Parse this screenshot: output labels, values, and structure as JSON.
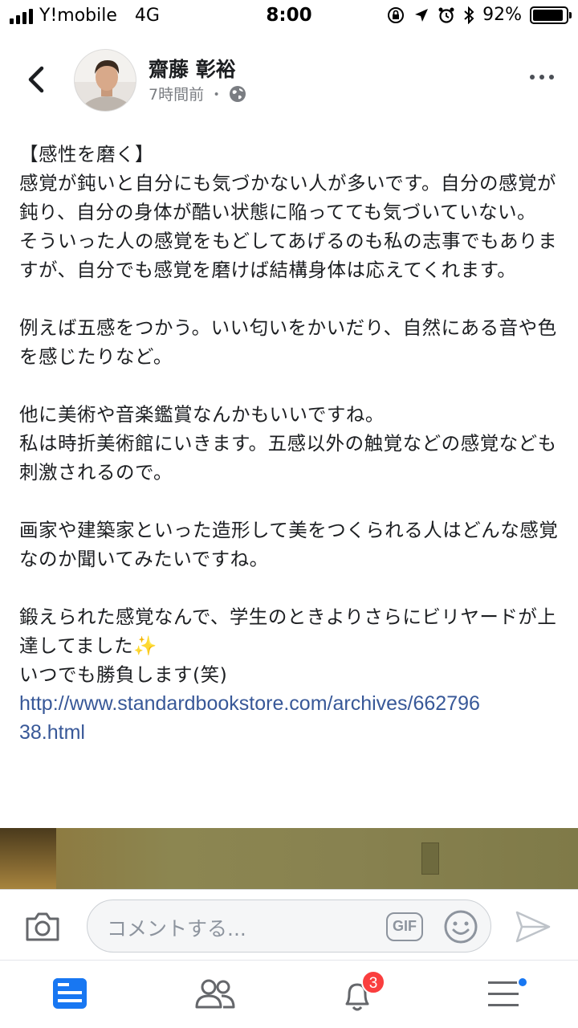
{
  "status_bar": {
    "carrier": "Y!mobile",
    "network": "4G",
    "time": "8:00",
    "battery": "92%",
    "battery_level": 0.92
  },
  "post": {
    "author": "齋藤 彰裕",
    "time_ago": "7時間前",
    "separator": "・",
    "paragraphs": [
      "【感性を磨く】\n感覚が鈍いと自分にも気づかない人が多いです。自分の感覚が鈍り、自分の身体が酷い状態に陥ってても気づいていない。\nそういった人の感覚をもどしてあげるのも私の志事でもありますが、自分でも感覚を磨けば結構身体は応えてくれます。",
      "例えば五感をつかう。いい匂いをかいだり、自然にある音や色を感じたりなど。",
      "他に美術や音楽鑑賞なんかもいいですね。\n私は時折美術館にいきます。五感以外の触覚などの感覚なども刺激されるので。",
      "画家や建築家といった造形して美をつくられる人はどんな感覚なのか聞いてみたいですね。",
      "鍛えられた感覚なんで、学生のときよりさらにビリヤードが上達してました✨\nいつでも勝負します(笑)"
    ],
    "link": "http://www.standardbookstore.com/archives/66279638.html"
  },
  "comment_bar": {
    "placeholder": "コメントする...",
    "gif_label": "GIF"
  },
  "bottom_nav": {
    "notification_count": "3",
    "active_color": "#1877f2",
    "inactive_color": "#65676b"
  }
}
